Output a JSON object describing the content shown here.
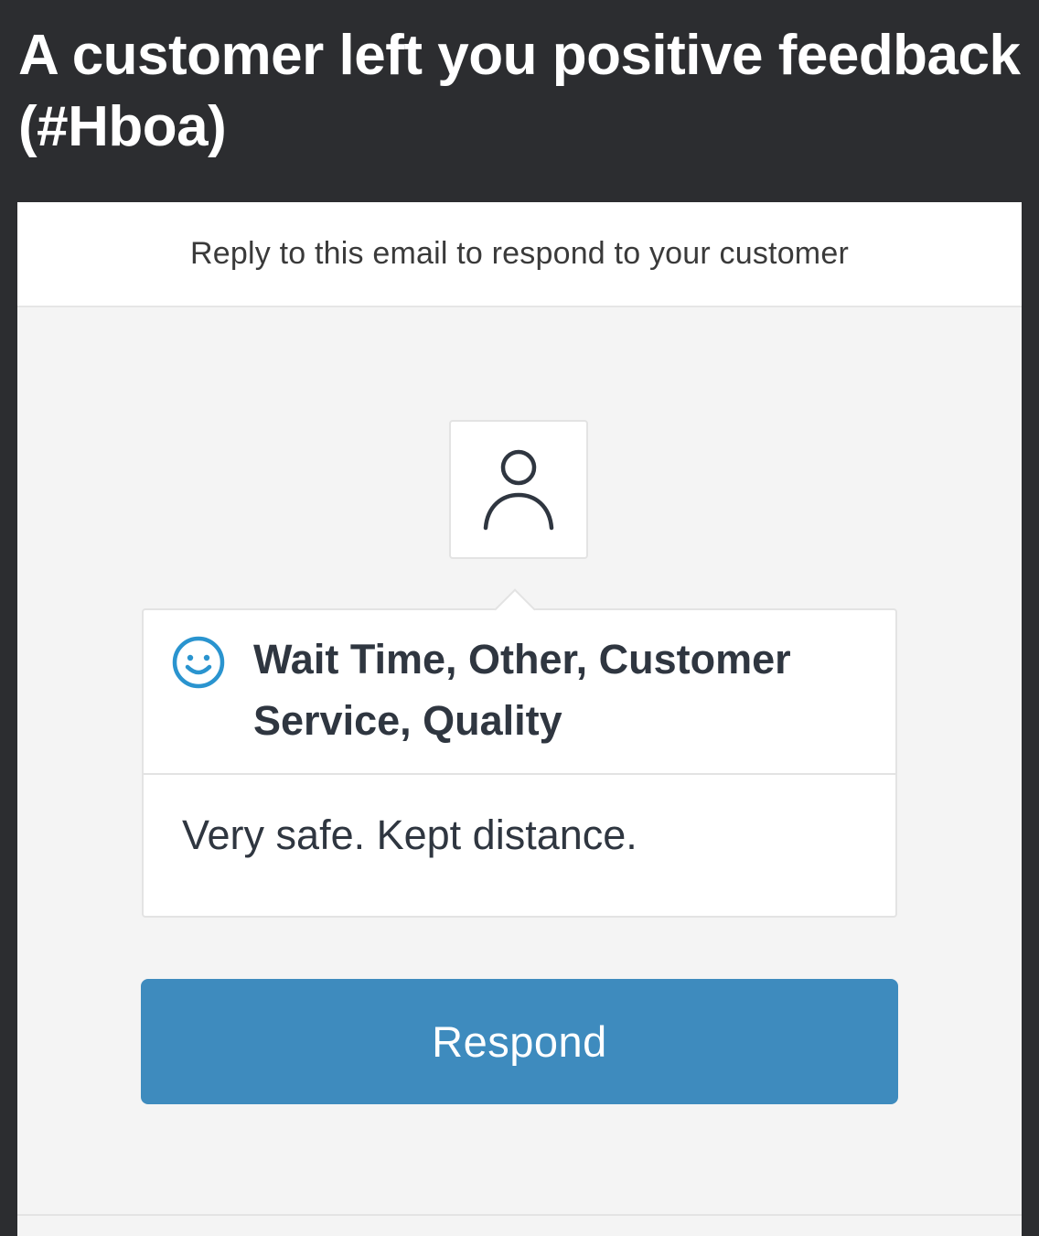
{
  "email": {
    "subject": "A customer left you positive feedback (#Hboa)",
    "reply_notice": "Reply to this email to respond to your customer"
  },
  "feedback": {
    "sentiment_icon": "smiley-face-icon",
    "avatar_icon": "person-icon",
    "categories": "Wait Time, Other, Customer Service, Quality",
    "comment": "Very safe. Kept distance."
  },
  "actions": {
    "respond_label": "Respond"
  },
  "colors": {
    "header_background": "#2c2d30",
    "card_background": "#f4f4f4",
    "accent_blue": "#3e8bbe",
    "smiley_blue": "#2a94cf",
    "text_dark": "#2f3640"
  }
}
